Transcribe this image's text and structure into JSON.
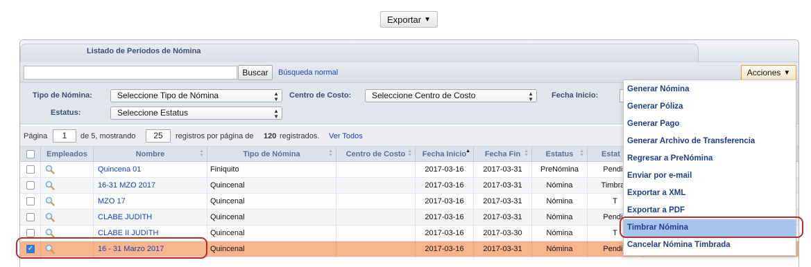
{
  "toolbar": {
    "export_label": "Exportar",
    "dropdown_arrow": "▼"
  },
  "panel": {
    "title": "Listado de Períodos de Nómina"
  },
  "search": {
    "button": "Buscar",
    "link": "Búsqueda normal",
    "actions_label": "Acciones"
  },
  "filters": {
    "tipo_label": "Tipo de Nómina:",
    "tipo_value": "Seleccione Tipo de Nómina",
    "centro_label": "Centro de Costo:",
    "centro_value": "Seleccione Centro de Costo",
    "fecha_label": "Fecha Inicio:",
    "estatus_label": "Estatus:",
    "estatus_value": "Seleccione Estatus"
  },
  "pager": {
    "pagina": "Página",
    "page": "1",
    "de": "de 5, mostrando",
    "per_page": "25",
    "registros": "registros por página de",
    "total": "120",
    "registrados": "registrados.",
    "ver_todos": "Ver Todos"
  },
  "columns": [
    "Empleados",
    "Nombre",
    "Tipo de Nómina",
    "Centro de Costo",
    "Fecha Inicio",
    "Fecha Fin",
    "Estatus",
    "Estat"
  ],
  "rows": [
    {
      "nombre": "Quincena 01",
      "tipo": "Finiquito",
      "inicio": "2017-03-16",
      "fin": "2017-03-31",
      "estatus": "PreNómina",
      "estat": "Pendie"
    },
    {
      "nombre": "16-31 MZO 2017",
      "tipo": "Quincenal",
      "inicio": "2017-03-16",
      "fin": "2017-03-31",
      "estatus": "Nómina",
      "estat": "Timbrad"
    },
    {
      "nombre": "MZO 17",
      "tipo": "Quincenal",
      "inicio": "2017-03-16",
      "fin": "2017-03-31",
      "estatus": "Nómina",
      "estat": "T"
    },
    {
      "nombre": "CLABE JUDITH",
      "tipo": "Quincenal",
      "inicio": "2017-03-16",
      "fin": "2017-03-31",
      "estatus": "Nómina",
      "estat": "Pendie"
    },
    {
      "nombre": "CLABE II JUDITH",
      "tipo": "Quincenal",
      "inicio": "2017-03-16",
      "fin": "2017-03-30",
      "estatus": "Nómina",
      "estat": "T"
    },
    {
      "nombre": "16 - 31 Marzo 2017",
      "tipo": "Quincenal",
      "inicio": "2017-03-16",
      "fin": "2017-03-31",
      "estatus": "Nómina",
      "estat": "Pendie"
    }
  ],
  "menu": {
    "items": [
      "Generar Nómina",
      "Generar Póliza",
      "Generar Pago",
      "Generar Archivo de Transferencia",
      "Regresar a PreNómina",
      "Enviar por e-mail",
      "Exportar a XML",
      "Exportar a PDF",
      "Timbrar Nómina",
      "Cancelar Nómina Timbrada"
    ],
    "highlighted_index": 8
  },
  "colors": {
    "accent_link": "#1a3fb5",
    "selected_row": "#f8b48c",
    "menu_highlight": "#a6c4ee",
    "annotation": "#b03028"
  },
  "icons": {
    "row_view": "magnifier-icon",
    "checked": "checkmark-icon"
  }
}
